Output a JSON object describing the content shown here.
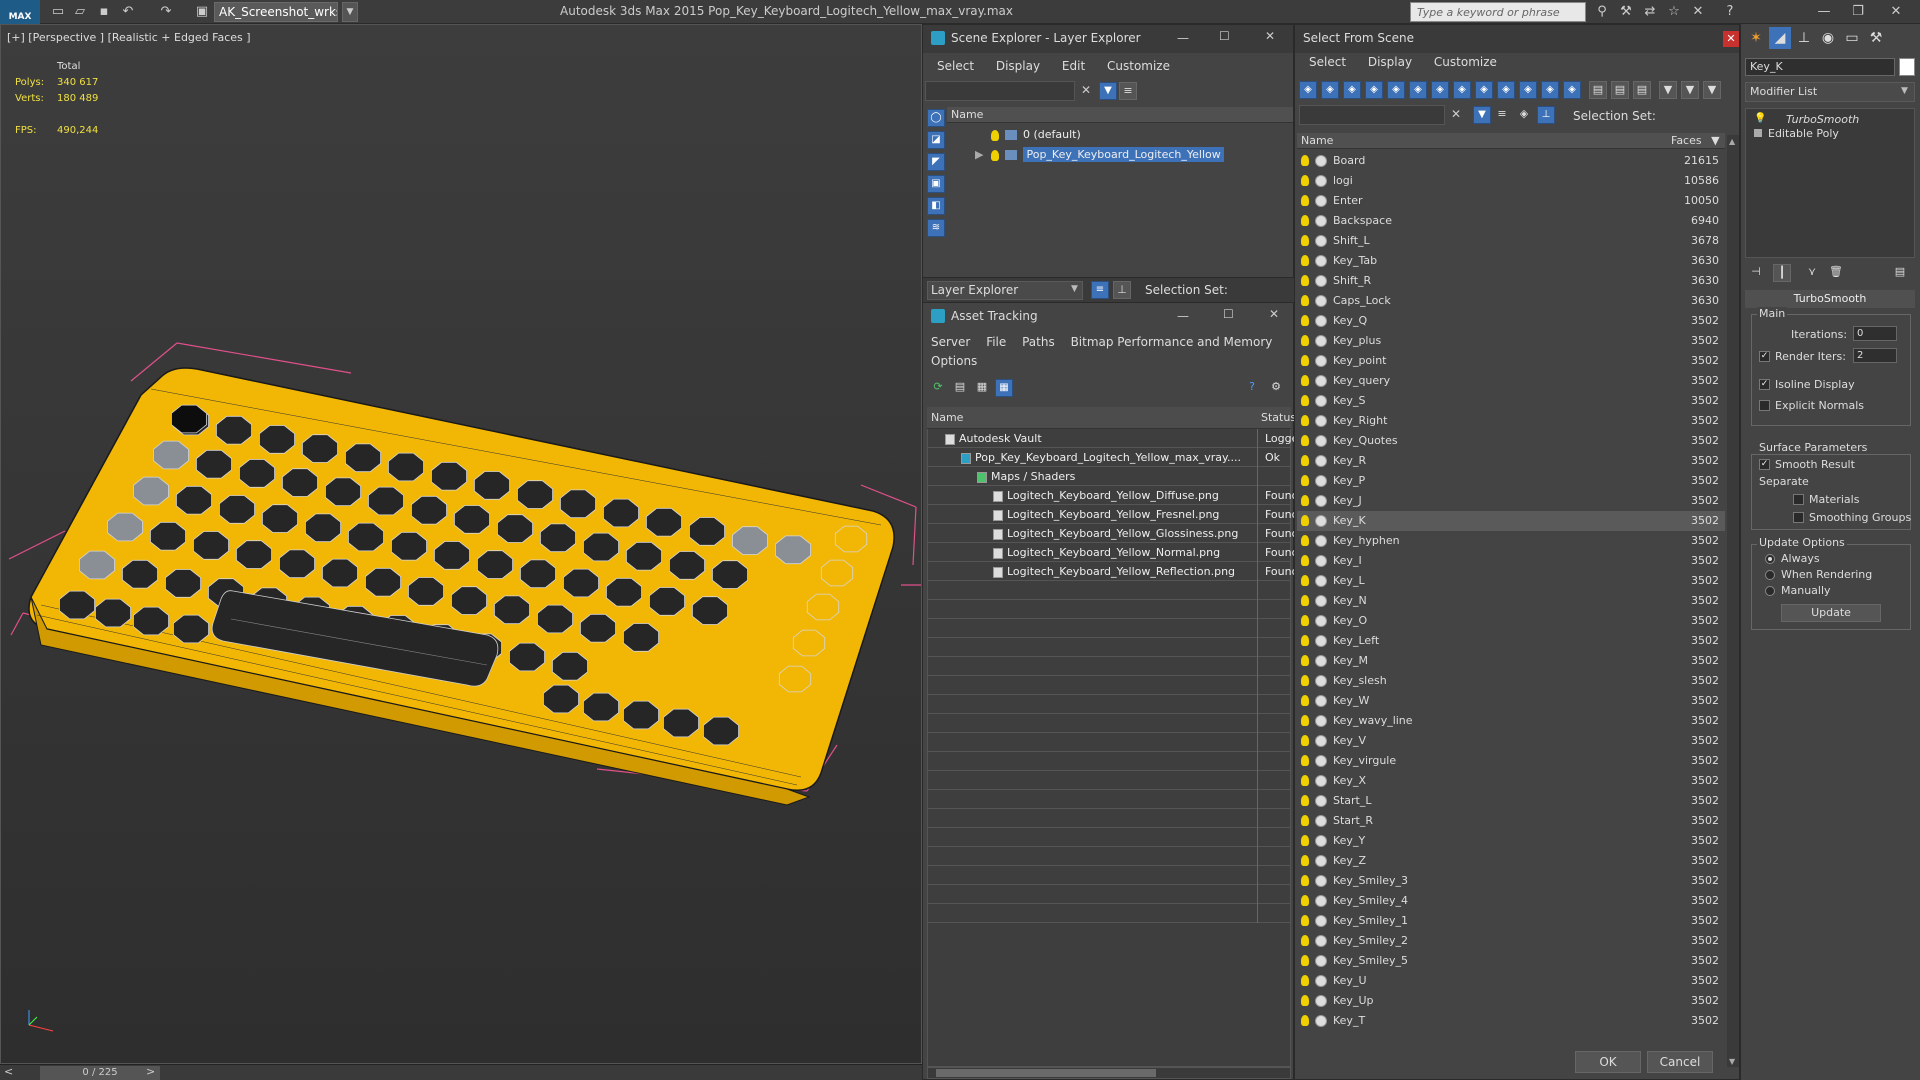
{
  "titlebar": {
    "logo": "MAX",
    "workspace": "AK_Screenshot_wrksp",
    "app_title": "Autodesk 3ds Max  2015      Pop_Key_Keyboard_Logitech_Yellow_max_vray.max",
    "search_placeholder": "Type a keyword or phrase"
  },
  "viewport": {
    "label": "[+] [Perspective ] [Realistic + Edged Faces ]",
    "stats": {
      "total_label": "Total",
      "polys_label": "Polys:",
      "polys_value": "340 617",
      "verts_label": "Verts:",
      "verts_value": "180 489",
      "fps_label": "FPS:",
      "fps_value": "490,244"
    },
    "frame_counter": "0 / 225",
    "colors": {
      "accent_yellow": "#f2b705",
      "wire": "#1a1a1a",
      "selection_bracket": "#e0508a"
    }
  },
  "scene_explorer": {
    "title": "Scene Explorer - Layer Explorer",
    "menu": [
      "Select",
      "Display",
      "Edit",
      "Customize"
    ],
    "column_name": "Name",
    "layers": [
      {
        "name": "0 (default)",
        "selected": false
      },
      {
        "name": "Pop_Key_Keyboard_Logitech_Yellow",
        "selected": true
      }
    ],
    "footer_dropdown": "Layer Explorer",
    "selection_set_label": "Selection Set:"
  },
  "asset_tracking": {
    "title": "Asset Tracking",
    "menu_row1": [
      "Server",
      "File",
      "Paths",
      "Bitmap Performance and Memory"
    ],
    "menu_row2": [
      "Options"
    ],
    "col_name": "Name",
    "col_status": "Status",
    "rows": [
      {
        "name": "Autodesk Vault",
        "status": "Logge",
        "indent": 0
      },
      {
        "name": "Pop_Key_Keyboard_Logitech_Yellow_max_vray....",
        "status": "Ok",
        "indent": 1
      },
      {
        "name": "Maps / Shaders",
        "status": "",
        "indent": 2
      },
      {
        "name": "Logitech_Keyboard_Yellow_Diffuse.png",
        "status": "Found",
        "indent": 3
      },
      {
        "name": "Logitech_Keyboard_Yellow_Fresnel.png",
        "status": "Found",
        "indent": 3
      },
      {
        "name": "Logitech_Keyboard_Yellow_Glossiness.png",
        "status": "Found",
        "indent": 3
      },
      {
        "name": "Logitech_Keyboard_Yellow_Normal.png",
        "status": "Found",
        "indent": 3
      },
      {
        "name": "Logitech_Keyboard_Yellow_Reflection.png",
        "status": "Found",
        "indent": 3
      }
    ]
  },
  "select_from_scene": {
    "title": "Select From Scene",
    "menu": [
      "Select",
      "Display",
      "Customize"
    ],
    "selection_set_label": "Selection Set:",
    "col_name": "Name",
    "col_faces": "Faces",
    "rows": [
      {
        "name": "Board",
        "faces": "21615"
      },
      {
        "name": "logi",
        "faces": "10586"
      },
      {
        "name": "Enter",
        "faces": "10050"
      },
      {
        "name": "Backspace",
        "faces": "6940"
      },
      {
        "name": "Shift_L",
        "faces": "3678"
      },
      {
        "name": "Key_Tab",
        "faces": "3630"
      },
      {
        "name": "Shift_R",
        "faces": "3630"
      },
      {
        "name": "Caps_Lock",
        "faces": "3630"
      },
      {
        "name": "Key_Q",
        "faces": "3502"
      },
      {
        "name": "Key_plus",
        "faces": "3502"
      },
      {
        "name": "Key_point",
        "faces": "3502"
      },
      {
        "name": "Key_query",
        "faces": "3502"
      },
      {
        "name": "Key_S",
        "faces": "3502"
      },
      {
        "name": "Key_Right",
        "faces": "3502"
      },
      {
        "name": "Key_Quotes",
        "faces": "3502"
      },
      {
        "name": "Key_R",
        "faces": "3502"
      },
      {
        "name": "Key_P",
        "faces": "3502"
      },
      {
        "name": "Key_J",
        "faces": "3502"
      },
      {
        "name": "Key_K",
        "faces": "3502",
        "selected": true
      },
      {
        "name": "Key_hyphen",
        "faces": "3502"
      },
      {
        "name": "Key_I",
        "faces": "3502"
      },
      {
        "name": "Key_L",
        "faces": "3502"
      },
      {
        "name": "Key_N",
        "faces": "3502"
      },
      {
        "name": "Key_O",
        "faces": "3502"
      },
      {
        "name": "Key_Left",
        "faces": "3502"
      },
      {
        "name": "Key_M",
        "faces": "3502"
      },
      {
        "name": "Key_slesh",
        "faces": "3502"
      },
      {
        "name": "Key_W",
        "faces": "3502"
      },
      {
        "name": "Key_wavy_line",
        "faces": "3502"
      },
      {
        "name": "Key_V",
        "faces": "3502"
      },
      {
        "name": "Key_virgule",
        "faces": "3502"
      },
      {
        "name": "Key_X",
        "faces": "3502"
      },
      {
        "name": "Start_L",
        "faces": "3502"
      },
      {
        "name": "Start_R",
        "faces": "3502"
      },
      {
        "name": "Key_Y",
        "faces": "3502"
      },
      {
        "name": "Key_Z",
        "faces": "3502"
      },
      {
        "name": "Key_Smiley_3",
        "faces": "3502"
      },
      {
        "name": "Key_Smiley_4",
        "faces": "3502"
      },
      {
        "name": "Key_Smiley_1",
        "faces": "3502"
      },
      {
        "name": "Key_Smiley_2",
        "faces": "3502"
      },
      {
        "name": "Key_Smiley_5",
        "faces": "3502"
      },
      {
        "name": "Key_U",
        "faces": "3502"
      },
      {
        "name": "Key_Up",
        "faces": "3502"
      },
      {
        "name": "Key_T",
        "faces": "3502"
      }
    ],
    "ok_label": "OK",
    "cancel_label": "Cancel"
  },
  "command_panel": {
    "object_name": "Key_K",
    "modifier_list": "Modifier List",
    "stack": [
      "TurboSmooth",
      "Editable Poly"
    ],
    "rollout_title": "TurboSmooth",
    "main_label": "Main",
    "iterations_label": "Iterations:",
    "iterations_value": "0",
    "render_iters_label": "Render Iters:",
    "render_iters_value": "2",
    "isoline_label": "Isoline Display",
    "explicit_normals_label": "Explicit Normals",
    "surface_params_label": "Surface Parameters",
    "smooth_result_label": "Smooth Result",
    "separate_label": "Separate",
    "materials_label": "Materials",
    "smoothing_groups_label": "Smoothing Groups",
    "update_options_label": "Update Options",
    "always_label": "Always",
    "when_rendering_label": "When Rendering",
    "manually_label": "Manually",
    "update_button": "Update"
  }
}
